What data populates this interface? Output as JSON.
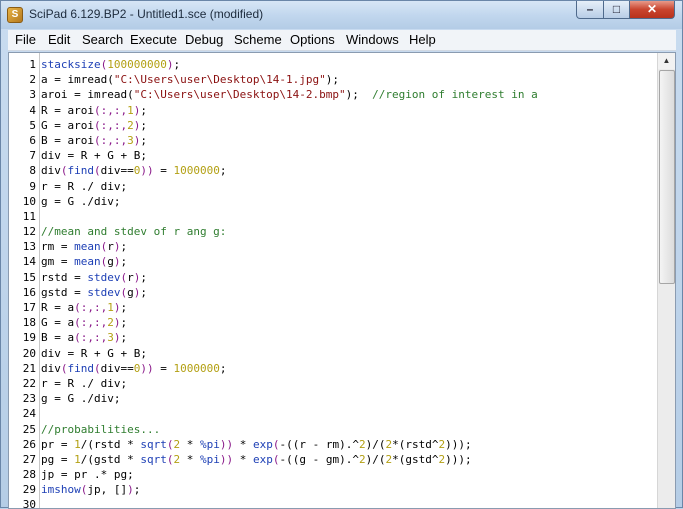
{
  "window": {
    "title": "SciPad 6.129.BP2 - Untitled1.sce (modified)"
  },
  "menu": [
    "File",
    "Edit",
    "Search",
    "Execute",
    "Debug",
    "Scheme",
    "Options",
    "Windows",
    "Help"
  ],
  "lines": [
    {
      "n": "1",
      "tokens": [
        [
          "fn",
          "stacksize"
        ],
        [
          "par",
          "("
        ],
        [
          "num",
          "100000000"
        ],
        [
          "par",
          ")"
        ],
        [
          "plain",
          ";"
        ]
      ]
    },
    {
      "n": "2",
      "tokens": [
        [
          "plain",
          "a = imread("
        ],
        [
          "str",
          "\"C:\\Users\\user\\Desktop\\14-1.jpg\""
        ],
        [
          "plain",
          ");"
        ]
      ]
    },
    {
      "n": "3",
      "tokens": [
        [
          "plain",
          "aroi = imread("
        ],
        [
          "str",
          "\"C:\\Users\\user\\Desktop\\14-2.bmp\""
        ],
        [
          "plain",
          ");  "
        ],
        [
          "com",
          "//region of interest in a"
        ]
      ]
    },
    {
      "n": "4",
      "tokens": [
        [
          "plain",
          "R = aroi"
        ],
        [
          "par",
          "(:,:,"
        ],
        [
          "num",
          "1"
        ],
        [
          "par",
          ")"
        ],
        [
          "plain",
          ";"
        ]
      ]
    },
    {
      "n": "5",
      "tokens": [
        [
          "plain",
          "G = aroi"
        ],
        [
          "par",
          "(:,:,"
        ],
        [
          "num",
          "2"
        ],
        [
          "par",
          ")"
        ],
        [
          "plain",
          ";"
        ]
      ]
    },
    {
      "n": "6",
      "tokens": [
        [
          "plain",
          "B = aroi"
        ],
        [
          "par",
          "(:,:,"
        ],
        [
          "num",
          "3"
        ],
        [
          "par",
          ")"
        ],
        [
          "plain",
          ";"
        ]
      ]
    },
    {
      "n": "7",
      "tokens": [
        [
          "plain",
          "div = R + G + B;"
        ]
      ]
    },
    {
      "n": "8",
      "tokens": [
        [
          "plain",
          "div"
        ],
        [
          "par",
          "("
        ],
        [
          "fn",
          "find"
        ],
        [
          "par",
          "("
        ],
        [
          "plain",
          "div=="
        ],
        [
          "num",
          "0"
        ],
        [
          "par",
          "))"
        ],
        [
          "plain",
          " = "
        ],
        [
          "num",
          "1000000"
        ],
        [
          "plain",
          ";"
        ]
      ]
    },
    {
      "n": "9",
      "tokens": [
        [
          "plain",
          "r = R ./ div;"
        ]
      ]
    },
    {
      "n": "10",
      "tokens": [
        [
          "plain",
          "g = G ./div;"
        ]
      ]
    },
    {
      "n": "11",
      "tokens": []
    },
    {
      "n": "12",
      "tokens": [
        [
          "com",
          "//mean and stdev of r ang g:"
        ]
      ]
    },
    {
      "n": "13",
      "tokens": [
        [
          "plain",
          "rm = "
        ],
        [
          "fn",
          "mean"
        ],
        [
          "par",
          "("
        ],
        [
          "plain",
          "r"
        ],
        [
          "par",
          ")"
        ],
        [
          "plain",
          ";"
        ]
      ]
    },
    {
      "n": "14",
      "tokens": [
        [
          "plain",
          "gm = "
        ],
        [
          "fn",
          "mean"
        ],
        [
          "par",
          "("
        ],
        [
          "plain",
          "g"
        ],
        [
          "par",
          ")"
        ],
        [
          "plain",
          ";"
        ]
      ]
    },
    {
      "n": "15",
      "tokens": [
        [
          "plain",
          "rstd = "
        ],
        [
          "fn",
          "stdev"
        ],
        [
          "par",
          "("
        ],
        [
          "plain",
          "r"
        ],
        [
          "par",
          ")"
        ],
        [
          "plain",
          ";"
        ]
      ]
    },
    {
      "n": "16",
      "tokens": [
        [
          "plain",
          "gstd = "
        ],
        [
          "fn",
          "stdev"
        ],
        [
          "par",
          "("
        ],
        [
          "plain",
          "g"
        ],
        [
          "par",
          ")"
        ],
        [
          "plain",
          ";"
        ]
      ]
    },
    {
      "n": "17",
      "tokens": [
        [
          "plain",
          "R = a"
        ],
        [
          "par",
          "(:,:,"
        ],
        [
          "num",
          "1"
        ],
        [
          "par",
          ")"
        ],
        [
          "plain",
          ";"
        ]
      ]
    },
    {
      "n": "18",
      "tokens": [
        [
          "plain",
          "G = a"
        ],
        [
          "par",
          "(:,:,"
        ],
        [
          "num",
          "2"
        ],
        [
          "par",
          ")"
        ],
        [
          "plain",
          ";"
        ]
      ]
    },
    {
      "n": "19",
      "tokens": [
        [
          "plain",
          "B = a"
        ],
        [
          "par",
          "(:,:,"
        ],
        [
          "num",
          "3"
        ],
        [
          "par",
          ")"
        ],
        [
          "plain",
          ";"
        ]
      ]
    },
    {
      "n": "20",
      "tokens": [
        [
          "plain",
          "div = R + G + B;"
        ]
      ]
    },
    {
      "n": "21",
      "tokens": [
        [
          "plain",
          "div"
        ],
        [
          "par",
          "("
        ],
        [
          "fn",
          "find"
        ],
        [
          "par",
          "("
        ],
        [
          "plain",
          "div=="
        ],
        [
          "num",
          "0"
        ],
        [
          "par",
          "))"
        ],
        [
          "plain",
          " = "
        ],
        [
          "num",
          "1000000"
        ],
        [
          "plain",
          ";"
        ]
      ]
    },
    {
      "n": "22",
      "tokens": [
        [
          "plain",
          "r = R ./ div;"
        ]
      ]
    },
    {
      "n": "23",
      "tokens": [
        [
          "plain",
          "g = G ./div;"
        ]
      ]
    },
    {
      "n": "24",
      "tokens": []
    },
    {
      "n": "25",
      "tokens": [
        [
          "com",
          "//probabilities..."
        ]
      ]
    },
    {
      "n": "26",
      "tokens": [
        [
          "plain",
          "pr = "
        ],
        [
          "num",
          "1"
        ],
        [
          "plain",
          "/(rstd * "
        ],
        [
          "fn",
          "sqrt"
        ],
        [
          "par",
          "("
        ],
        [
          "num",
          "2"
        ],
        [
          "plain",
          " * "
        ],
        [
          "fn",
          "%pi"
        ],
        [
          "par",
          "))"
        ],
        [
          "plain",
          " * "
        ],
        [
          "fn",
          "exp"
        ],
        [
          "par",
          "("
        ],
        [
          "plain",
          "-((r - rm).^"
        ],
        [
          "num",
          "2"
        ],
        [
          "plain",
          ")/("
        ],
        [
          "num",
          "2"
        ],
        [
          "plain",
          "*(rstd^"
        ],
        [
          "num",
          "2"
        ],
        [
          "plain",
          ")))"
        ],
        [
          "plain",
          ";"
        ]
      ]
    },
    {
      "n": "27",
      "tokens": [
        [
          "plain",
          "pg = "
        ],
        [
          "num",
          "1"
        ],
        [
          "plain",
          "/(gstd * "
        ],
        [
          "fn",
          "sqrt"
        ],
        [
          "par",
          "("
        ],
        [
          "num",
          "2"
        ],
        [
          "plain",
          " * "
        ],
        [
          "fn",
          "%pi"
        ],
        [
          "par",
          "))"
        ],
        [
          "plain",
          " * "
        ],
        [
          "fn",
          "exp"
        ],
        [
          "par",
          "("
        ],
        [
          "plain",
          "-((g - gm).^"
        ],
        [
          "num",
          "2"
        ],
        [
          "plain",
          ")/("
        ],
        [
          "num",
          "2"
        ],
        [
          "plain",
          "*(gstd^"
        ],
        [
          "num",
          "2"
        ],
        [
          "plain",
          ")))"
        ],
        [
          "plain",
          ";"
        ]
      ]
    },
    {
      "n": "28",
      "tokens": [
        [
          "plain",
          "jp = pr .* pg;"
        ]
      ]
    },
    {
      "n": "29",
      "tokens": [
        [
          "fn",
          "imshow"
        ],
        [
          "par",
          "("
        ],
        [
          "plain",
          "jp, []"
        ],
        [
          "par",
          ")"
        ],
        [
          "plain",
          ";"
        ]
      ]
    },
    {
      "n": "30",
      "tokens": []
    }
  ],
  "icons": {
    "app": "scipad-app-icon",
    "minimize": "minimize-icon",
    "maximize": "maximize-icon",
    "close": "close-icon",
    "scroll_up": "scroll-up-arrow-icon"
  }
}
